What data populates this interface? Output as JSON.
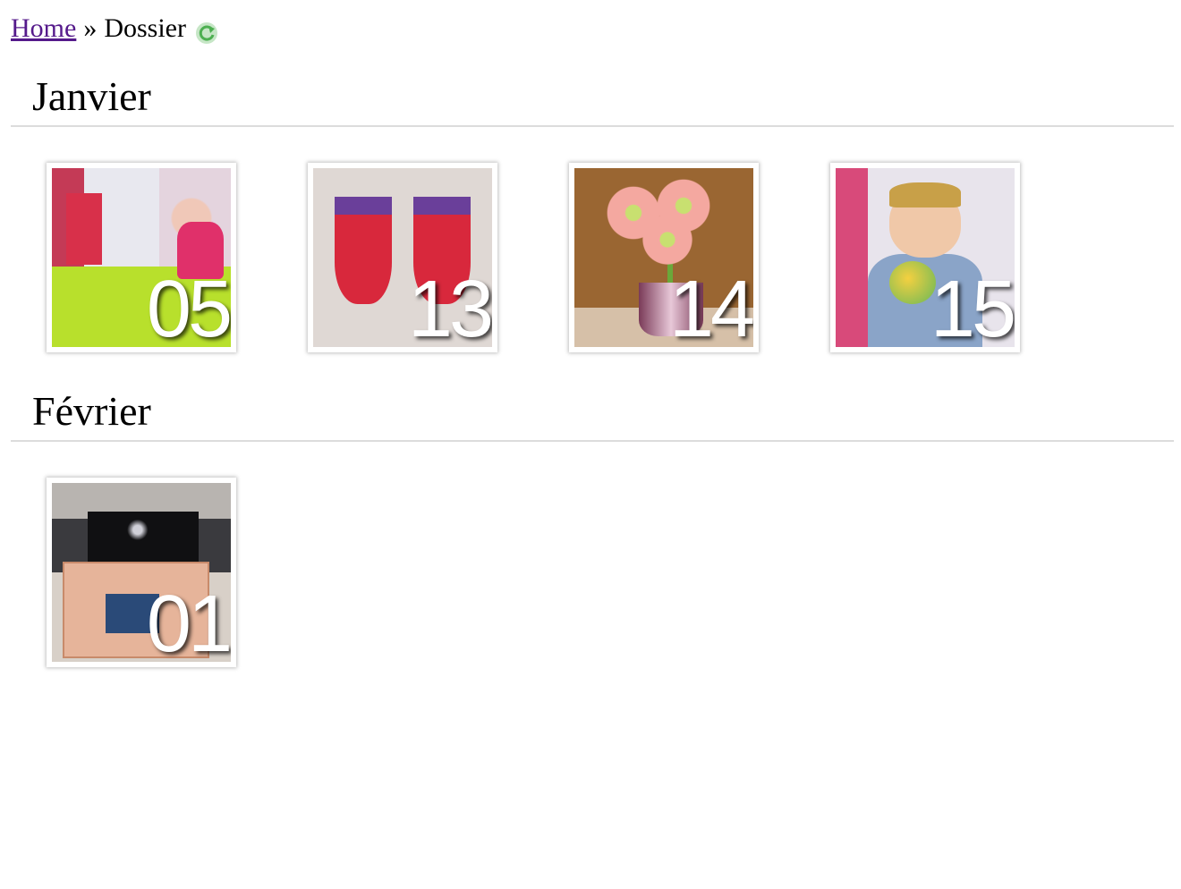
{
  "breadcrumb": {
    "home_label": "Home",
    "separator": "»",
    "current": "Dossier",
    "refresh_icon": "refresh-icon"
  },
  "months": [
    {
      "title": "Janvier",
      "photos": [
        {
          "day": "05"
        },
        {
          "day": "13"
        },
        {
          "day": "14"
        },
        {
          "day": "15"
        }
      ]
    },
    {
      "title": "Février",
      "photos": [
        {
          "day": "01"
        }
      ]
    }
  ],
  "colors": {
    "link_visited": "#551a8b",
    "divider": "#dcdcdc",
    "refresh_green": "#4caf50"
  }
}
